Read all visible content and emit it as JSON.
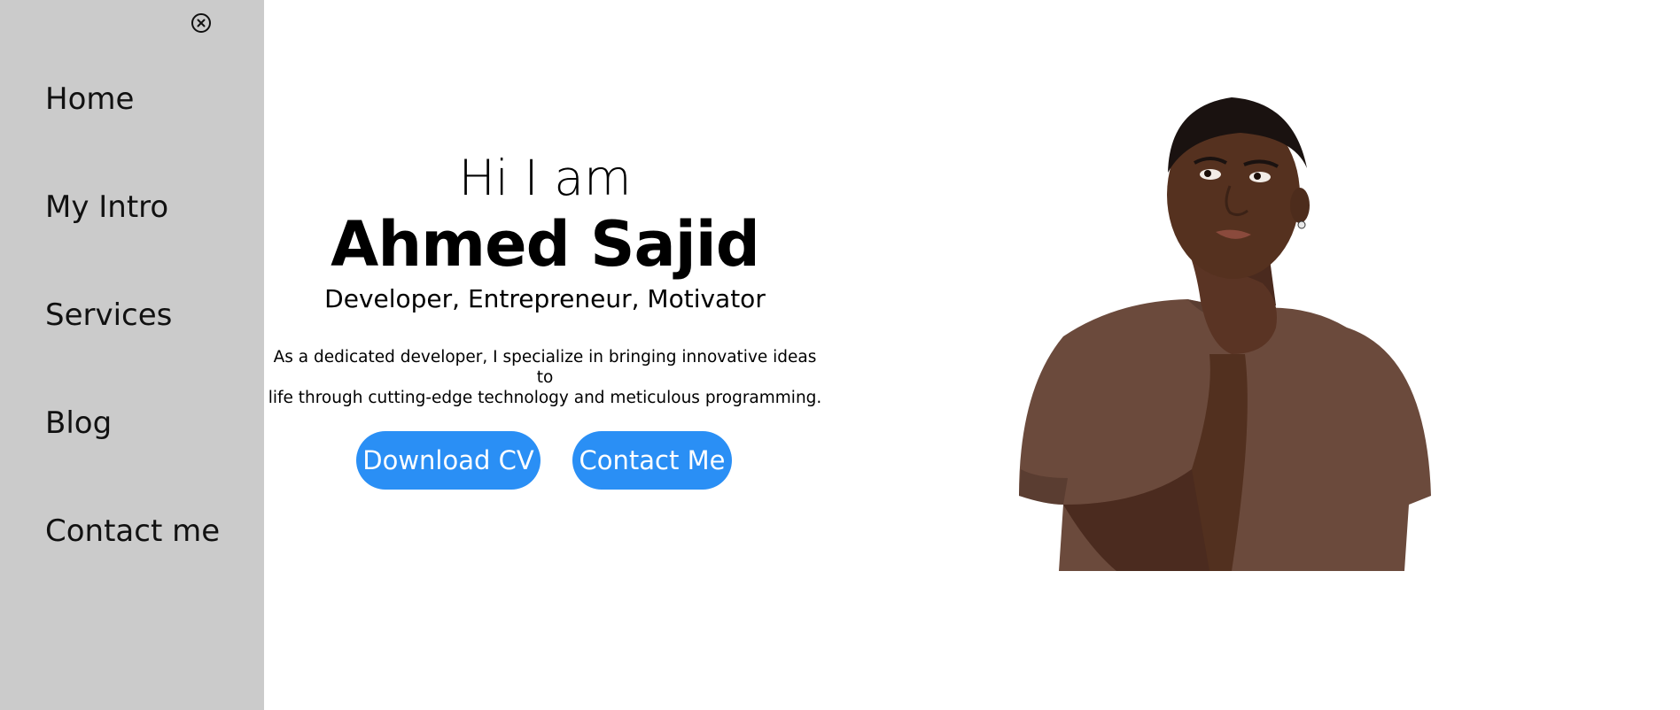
{
  "sidebar": {
    "close_icon": "close-circle-icon",
    "items": [
      {
        "label": "Home"
      },
      {
        "label": "My Intro"
      },
      {
        "label": "Services"
      },
      {
        "label": "Blog"
      },
      {
        "label": "Contact me"
      }
    ]
  },
  "hero": {
    "greeting": "Hi I am",
    "name": "Ahmed Sajid",
    "roles": "Developer, Entrepreneur, Motivator",
    "description_line1": "As a dedicated developer, I specialize in bringing innovative ideas to",
    "description_line2": "life through cutting-edge technology and meticulous programming.",
    "download_cv_label": "Download CV",
    "contact_label": "Contact Me"
  },
  "theme": {
    "sidebar_bg": "#cbcbcb",
    "accent": "#2a8ff5"
  }
}
